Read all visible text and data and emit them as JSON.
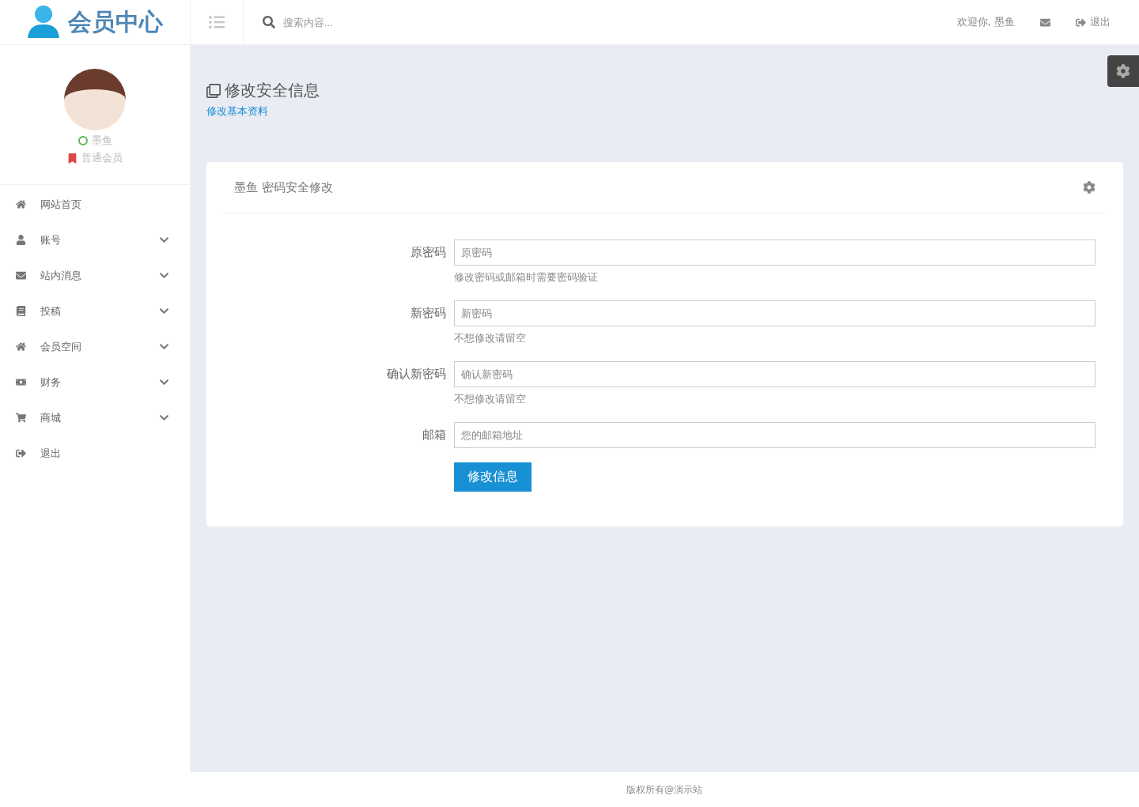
{
  "brand": {
    "title": "会员中心"
  },
  "search": {
    "placeholder": "搜索内容..."
  },
  "topbar": {
    "welcome": "欢迎你, 墨鱼",
    "logout": "退出"
  },
  "profile": {
    "name": "墨鱼",
    "online": true,
    "level": "普通会员"
  },
  "sidebar": {
    "items": [
      {
        "label": "网站首页"
      },
      {
        "label": "账号",
        "expanded": false
      },
      {
        "label": "站内消息",
        "expanded": false
      },
      {
        "label": "投稿",
        "expanded": false
      },
      {
        "label": "会员空间",
        "expanded": false
      },
      {
        "label": "财务",
        "expanded": false
      },
      {
        "label": "商城",
        "expanded": false
      },
      {
        "label": "退出"
      }
    ]
  },
  "page": {
    "title": "修改安全信息",
    "link": "修改基本资料"
  },
  "card": {
    "title": "墨鱼 密码安全修改",
    "fields": [
      {
        "label": "原密码",
        "placeholder": "原密码",
        "help": "修改密码或邮箱时需要密码验证"
      },
      {
        "label": "新密码",
        "placeholder": "新密码",
        "help": "不想修改请留空"
      },
      {
        "label": "确认新密码",
        "placeholder": "确认新密码",
        "help": "不想修改请留空"
      },
      {
        "label": "邮箱",
        "placeholder": "您的邮箱地址"
      }
    ],
    "submit": "修改信息"
  },
  "footer": {
    "text": "版权所有@演示站"
  }
}
